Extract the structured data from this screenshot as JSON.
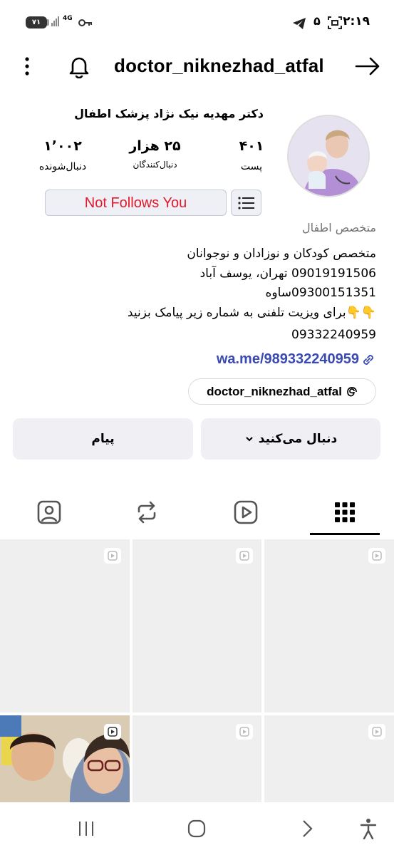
{
  "status_bar": {
    "time": "۲:۱۹",
    "battery": "۷۱",
    "network": "4G",
    "notification_count": "۵",
    "icons": [
      "telegram-icon",
      "screenshot-icon",
      "key-icon",
      "signal-icon",
      "battery-icon"
    ]
  },
  "header": {
    "username": "doctor_niknezhad_atfal",
    "icons": [
      "more-vertical-icon",
      "bell-icon",
      "back-arrow-icon"
    ]
  },
  "profile": {
    "full_name": "دکتر مهدیه نیک نژاد پزشک اطفال",
    "stats": {
      "posts": {
        "value": "۴۰۱",
        "label": "پست"
      },
      "followers": {
        "value": "۲۵ هزار",
        "label": "دنبال‌کنندگان"
      },
      "following": {
        "value": "۱٬۰۰۲",
        "label": "دنبال‌شونده"
      }
    },
    "not_follows_label": "Not Follows You",
    "category": "متخصص اطفال",
    "bio": {
      "line1": "متخصص کودکان و نوزادان و نوجوانان",
      "line2": "09019191506 تهران، یوسف آباد",
      "line3": "09300151351ساوه",
      "line4": "👇👇برای ویزیت تلفنی به شماره زیر پیامک بزنید",
      "line5": "09332240959"
    },
    "link": "wa.me/989332240959",
    "threads_handle": "doctor_niknezhad_atfal"
  },
  "actions": {
    "following_label": "دنبال می‌کنید",
    "message_label": "پیام"
  },
  "tabs": [
    {
      "icon": "tagged-icon"
    },
    {
      "icon": "reposts-icon"
    },
    {
      "icon": "reels-icon"
    },
    {
      "icon": "grid-icon",
      "selected": true
    }
  ],
  "grid_items": [
    "reel",
    "reel",
    "reel",
    "reel",
    "reel",
    "reel"
  ],
  "nav_bar": {
    "icons": [
      "recent-apps-icon",
      "home-icon",
      "back-icon",
      "accessibility-icon"
    ]
  },
  "colors": {
    "not_follows_text": "#e0192b",
    "link": "#3b4ab3",
    "button_bg": "#efeff4",
    "grid_bg": "#efefef"
  }
}
